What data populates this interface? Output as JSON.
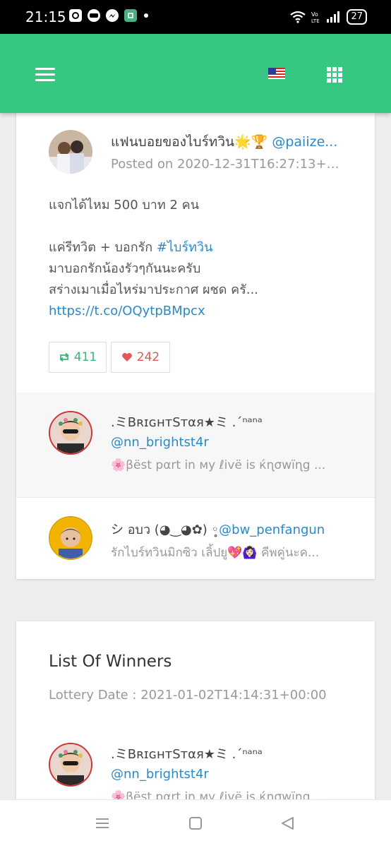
{
  "status_bar": {
    "time": "21:15",
    "battery": "27",
    "icons": [
      "camera-icon",
      "line-icon",
      "messenger-icon",
      "app-icon",
      "wifi-icon",
      "volte-icon",
      "signal-icon",
      "battery-icon"
    ]
  },
  "app_bar": {
    "brand_color": "#36c882",
    "icons": [
      "menu-icon",
      "us-flag-icon",
      "apps-grid-icon"
    ]
  },
  "post": {
    "author_name": "แฟนบอยของไบร์ทวิน🌟🏆",
    "author_handle": "@paiize...",
    "posted_on": "Posted on 2020-12-31T16:27:13+00...",
    "line1": "แจกได้ไหม 500 บาท 2 คน",
    "line2_prefix": "แค่รีทวิต + บอกรัก ",
    "hashtag": "#ไบร์ทวิน",
    "line3": "มาบอกรักน้องรัวๆกันนะครับ",
    "line4": "สร่างเมาเมื่อไหร่มาประกาศ ผชด ครั...",
    "link": "https://t.co/OQytpBMpcx",
    "retweets": "411",
    "likes": "242"
  },
  "participants": [
    {
      "name": ".ミBʀɪɢʜᴛSᴛαя★ミ .´ⁿᵃⁿᵃ",
      "handle": "@nn_brightst4r",
      "bio": "🌸βëst pαrt in мy ℓivë is ќɳσwïɳg ..."
    },
    {
      "name": "シ อบว (◕‿◕✿) ◦̥",
      "handle": "@bw_penfangun",
      "bio": "รักไบร์ทวินมิกซิว เลิ้ปยู💖🙆🏻‍♀️ คีพคู่นะค..."
    }
  ],
  "winners": {
    "title": "List Of Winners",
    "lottery_date": "Lottery Date : 2021-01-02T14:14:31+00:00",
    "first": {
      "name": ".ミBʀɪɢʜᴛSᴛαя★ミ .´ⁿᵃⁿᵃ",
      "handle": "@nn_brightst4r",
      "bio": "🌸βëst pαrt in мy ℓivë is ќɳσwïɳg ..."
    }
  },
  "nav_bar": {
    "icons": [
      "recent-apps-icon",
      "home-icon",
      "back-icon"
    ]
  }
}
